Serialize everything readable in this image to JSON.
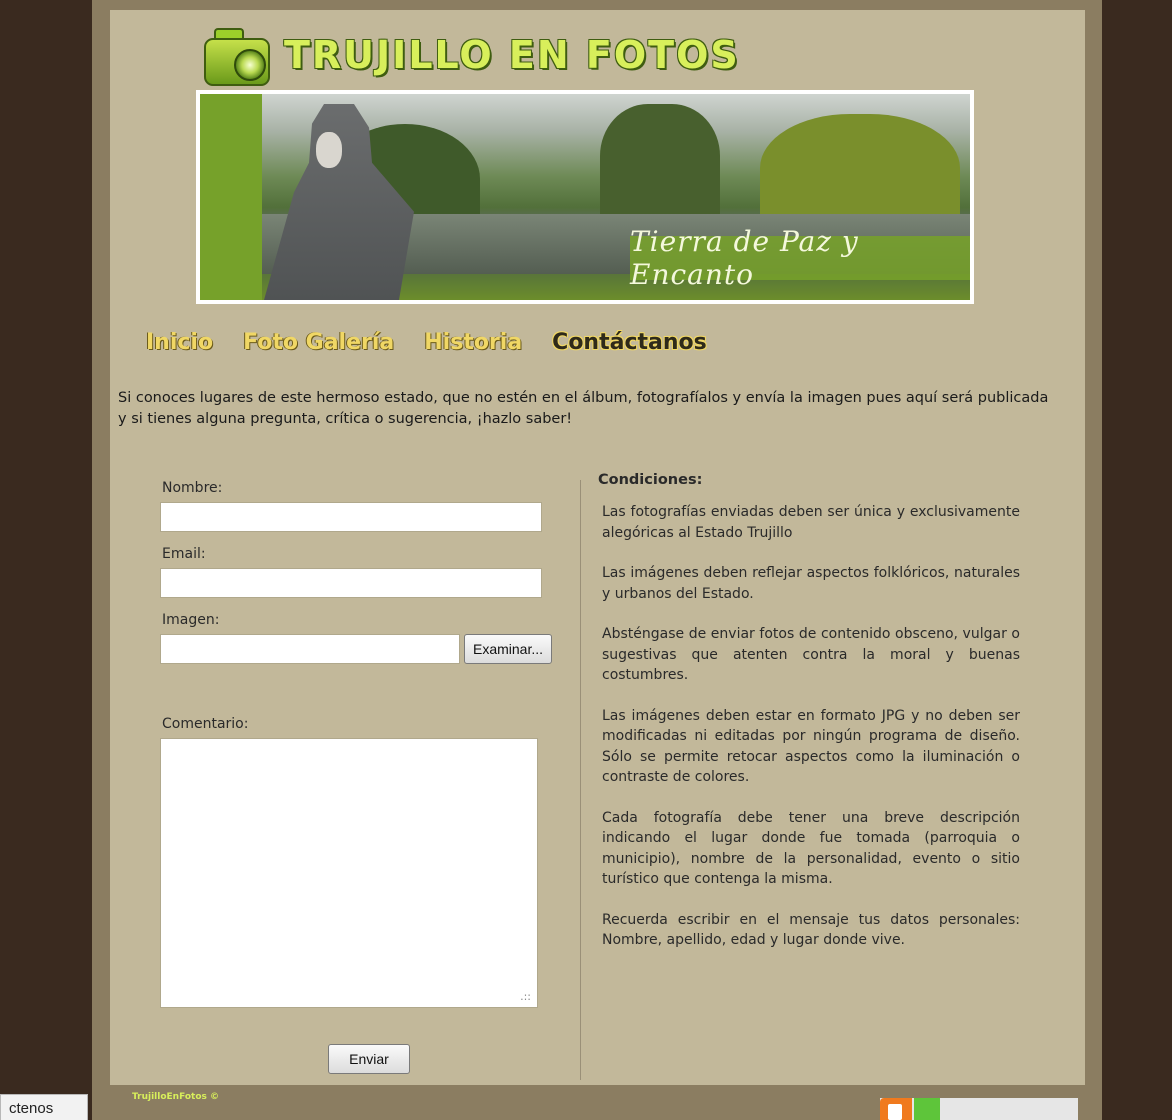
{
  "site": {
    "logo_text": "TRUJILLO EN FOTOS",
    "banner_caption": "Tierra de Paz y Encanto"
  },
  "nav": {
    "items": [
      {
        "label": "Inicio"
      },
      {
        "label": "Foto Galería"
      },
      {
        "label": "Historia"
      },
      {
        "label": "Contáctanos",
        "active": true
      }
    ]
  },
  "intro": "Si conoces lugares de este hermoso estado, que no estén en el álbum, fotografíalos y envía la imagen pues aquí será publicada y si tienes alguna pregunta, crítica o sugerencia, ¡hazlo saber!",
  "form": {
    "name_label": "Nombre:",
    "name_value": "",
    "email_label": "Email:",
    "email_value": "",
    "image_label": "Imagen:",
    "image_value": "",
    "browse_label": "Examinar...",
    "comment_label": "Comentario:",
    "comment_value": "",
    "submit_label": "Enviar"
  },
  "conditions": {
    "title": "Condiciones:",
    "items": [
      "Las fotografías enviadas deben ser única y exclusivamente alegóricas al Estado Trujillo",
      "Las imágenes deben reflejar aspectos folklóricos, naturales y urbanos del Estado.",
      "Absténgase de enviar fotos de contenido obsceno, vulgar o sugestivas que atenten contra la moral y buenas costumbres.",
      "Las imágenes deben estar en formato JPG y no deben ser modificadas ni editadas por ningún programa de diseño. Sólo se permite retocar aspectos como la iluminación o contraste de colores.",
      "Cada fotografía debe tener una breve descripción indicando el lugar donde fue tomada (parroquia o municipio), nombre de la personalidad, evento o sitio turístico que contenga la misma.",
      "Recuerda escribir en el mensaje tus datos personales: Nombre, apellido, edad y lugar donde vive."
    ]
  },
  "footer": {
    "copyright": "TrujilloEnFotos ©",
    "tab_stub": "ctenos"
  },
  "colors": {
    "outer_bg": "#3a2a1f",
    "page_border": "#8b7d61",
    "content_bg": "#c2b89a",
    "logo_green": "#d8ef5b",
    "nav_yellow": "#f0d765"
  }
}
